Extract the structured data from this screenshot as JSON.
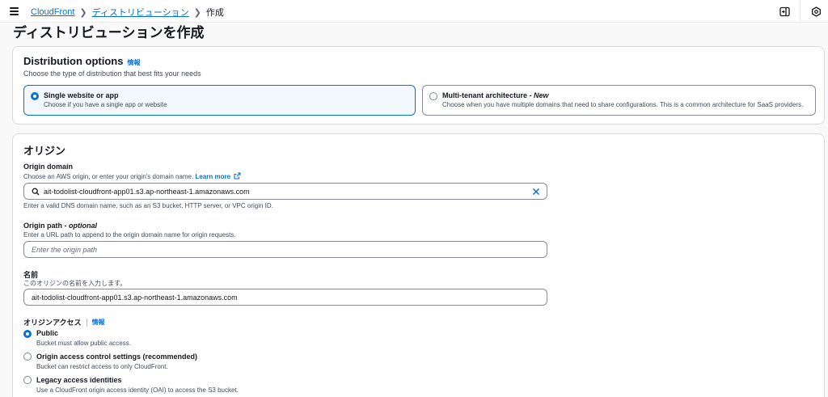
{
  "breadcrumb": {
    "items": [
      "CloudFront",
      "ディストリビューション"
    ],
    "current": "作成"
  },
  "page": {
    "title": "ディストリビューションを作成"
  },
  "distribution_options": {
    "title": "Distribution options",
    "info": "情報",
    "description": "Choose the type of distribution that best fits your needs",
    "options": [
      {
        "title": "Single website or app",
        "description": "Choose if you have a single app or website",
        "selected": true
      },
      {
        "title_prefix": "Multi-tenant architecture - ",
        "title_emphasis": "New",
        "description": "Choose when you have multiple domains that need to share configurations. This is a common architecture for SaaS providers.",
        "selected": false
      }
    ]
  },
  "origin": {
    "title": "オリジン",
    "domain": {
      "label": "Origin domain",
      "description": "Choose an AWS origin, or enter your origin's domain name.",
      "learn_more": "Learn more",
      "value": "ait-todolist-cloudfront-app01.s3.ap-northeast-1.amazonaws.com",
      "hint": "Enter a valid DNS domain name, such as an S3 bucket, HTTP server, or VPC origin ID."
    },
    "path": {
      "label": "Origin path - ",
      "label_emphasis": "optional",
      "description": "Enter a URL path to append to the origin domain name for origin requests.",
      "placeholder": "Enter the origin path"
    },
    "name": {
      "label": "名前",
      "description": "このオリジンの名前を入力します。",
      "value": "ait-todolist-cloudfront-app01.s3.ap-northeast-1.amazonaws.com"
    },
    "access": {
      "label": "オリジンアクセス",
      "info": "情報",
      "options": [
        {
          "title": "Public",
          "description": "Bucket must allow public access.",
          "selected": true
        },
        {
          "title": "Origin access control settings (recommended)",
          "description": "Bucket can restrict access to only CloudFront.",
          "selected": false
        },
        {
          "title": "Legacy access identities",
          "description": "Use a CloudFront origin access identity (OAI) to access the S3 bucket.",
          "selected": false
        }
      ]
    }
  },
  "colors": {
    "accent": "#0972d3",
    "text": "#16191f",
    "muted": "#414d5c",
    "border": "#8c8c94",
    "background": "#f9f9f9"
  },
  "icons": {
    "menu": "hamburger-menu-icon",
    "search": "search-icon",
    "clear": "close-icon",
    "external": "external-link-icon",
    "panel": "side-panel-icon",
    "settings": "settings-icon"
  }
}
